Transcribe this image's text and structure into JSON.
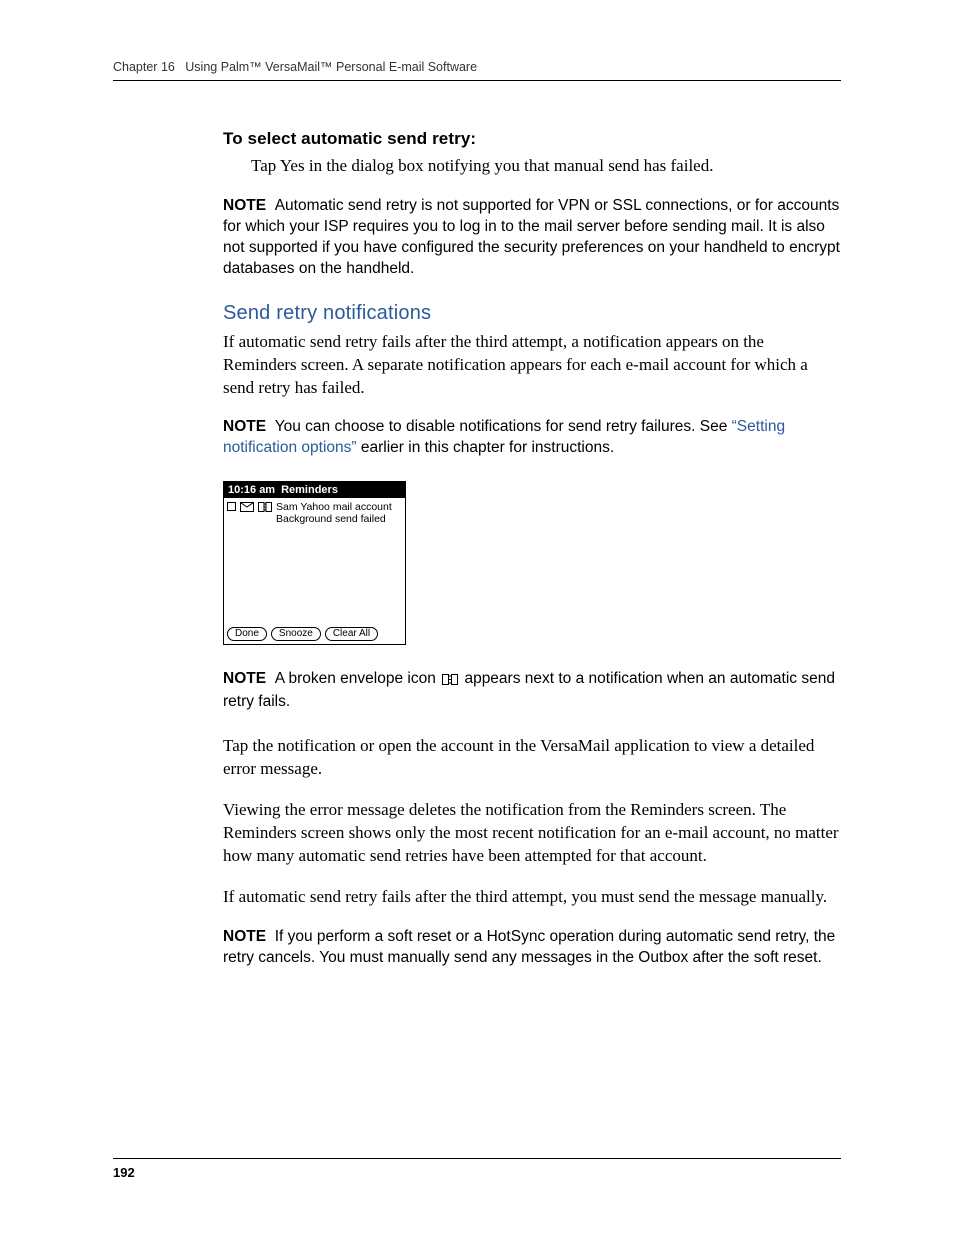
{
  "header": {
    "chapter": "Chapter 16",
    "title": "Using Palm™ VersaMail™ Personal E-mail Software"
  },
  "sections": {
    "select_retry": {
      "heading": "To select automatic send retry:",
      "body": "Tap Yes in the dialog box notifying you that manual send has failed."
    },
    "note1": {
      "label": "NOTE",
      "body": "Automatic send retry is not supported for VPN or SSL connections, or for accounts for which your ISP requires you to log in to the mail server before sending mail. It is also not supported if you have configured the security preferences on your handheld to encrypt databases on the handheld."
    },
    "notifications": {
      "heading": "Send retry notifications",
      "body": "If automatic send retry fails after the third attempt, a notification appears on the Reminders screen. A separate notification appears for each e-mail account for which a send retry has failed."
    },
    "note2": {
      "label": "NOTE",
      "pre": "You can choose to disable notifications for send retry failures. See ",
      "link": "“Setting notification options”",
      "post": " earlier in this chapter for instructions."
    },
    "screenshot": {
      "time": "10:16 am",
      "title": "Reminders",
      "line1": "Sam Yahoo mail account",
      "line2": "Background send failed",
      "buttons": {
        "done": "Done",
        "snooze": "Snooze",
        "clear": "Clear All"
      }
    },
    "note3": {
      "label": "NOTE",
      "pre": "A broken envelope icon ",
      "post": " appears next to a notification when an automatic send retry fails."
    },
    "para_tap": "Tap the notification or open the account in the VersaMail application to view a detailed error message.",
    "para_view": "Viewing the error message deletes the notification from the Reminders screen. The Reminders screen shows only the most recent notification for an e-mail account, no matter how many automatic send retries have been attempted for that account.",
    "para_manual": "If automatic send retry fails after the third attempt, you must send the message manually.",
    "note4": {
      "label": "NOTE",
      "body": "If you perform a soft reset or a HotSync operation during automatic send retry, the retry cancels. You must manually send any messages in the Outbox after the soft reset."
    }
  },
  "footer": {
    "page": "192"
  }
}
